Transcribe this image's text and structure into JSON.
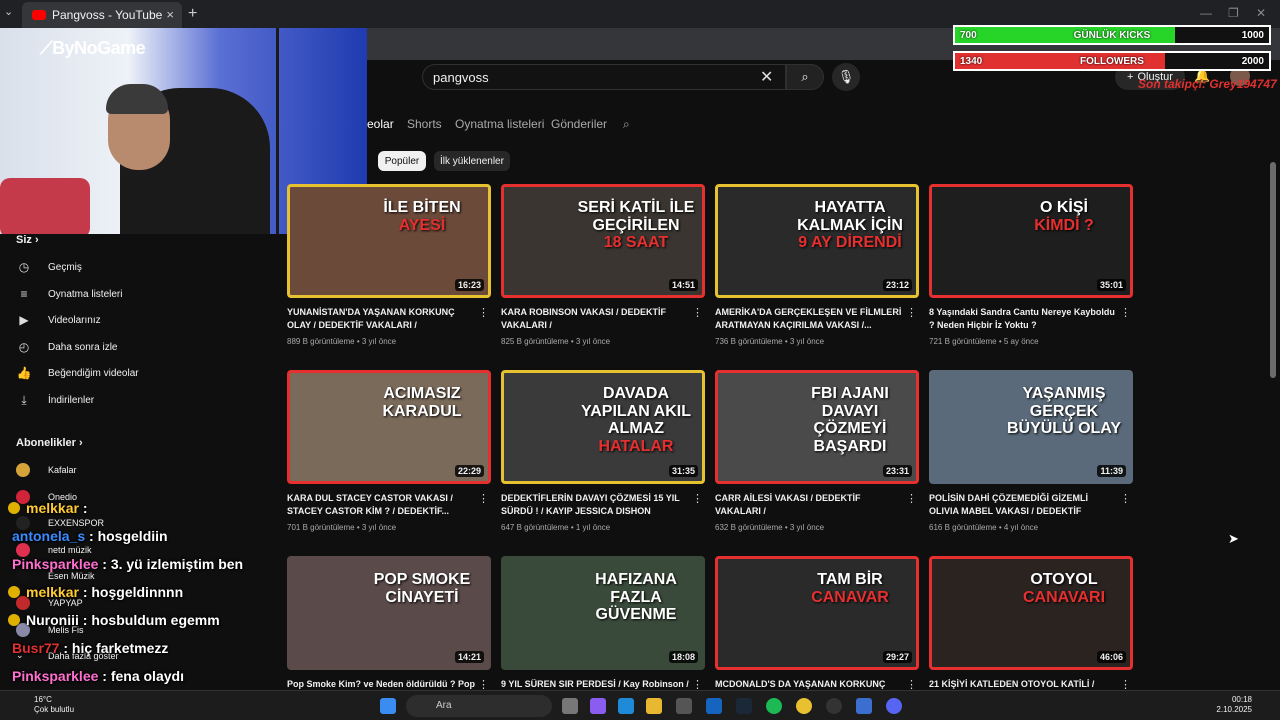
{
  "browser": {
    "tab_title": "Pangvoss - YouTube",
    "new_tab": "+",
    "tab_close": "×",
    "menu": "⌄"
  },
  "stream_overlay": {
    "logo": "ByNoGame",
    "stats": [
      {
        "current": "700",
        "label": "GÜNLÜK KICKS",
        "goal": "1000",
        "color": "#27d428",
        "fraction": 0.7
      },
      {
        "current": "1340",
        "label": "FOLLOWERS",
        "goal": "2000",
        "color": "#e03030",
        "fraction": 0.67
      }
    ],
    "last_follower": "Son takipçi: Grey194747"
  },
  "header": {
    "search_value": "pangvoss",
    "create_label": "Oluştur"
  },
  "channel_tabs": [
    "eolar",
    "Shorts",
    "Oynatma listeleri",
    "Gönderiler"
  ],
  "filters": [
    "Popüler",
    "İlk yüklenenler"
  ],
  "sidebar": {
    "you_heading": "Siz",
    "you_items": [
      "Geçmiş",
      "Oynatma listeleri",
      "Videolarınız",
      "Daha sonra izle",
      "Beğendiğim videolar",
      "İndirilenler"
    ],
    "subs_heading": "Abonelikler",
    "subs_items": [
      "Kafalar",
      "Onedio",
      "EXXENSPOR",
      "netd müzik",
      "Esen Müzik",
      "YAPYAP",
      "Melis Fis"
    ],
    "more": "Daha fazla göster"
  },
  "chat": [
    {
      "user": "melkkar",
      "msg": ":",
      "color": "#ffcc33"
    },
    {
      "user": "antonela_s",
      "msg": ": hosgeldiin",
      "color": "#3a8bff"
    },
    {
      "user": "Pinksparklee",
      "msg": ": 3. yü izlemiştim ben",
      "color": "#ff6fcf"
    },
    {
      "user": "melkkar",
      "msg": ": hoşgeldinnnn",
      "color": "#ffcc33"
    },
    {
      "user": "Nuroniii",
      "msg": ": hosbuldum egemm",
      "color": "#ffffff"
    },
    {
      "user": "Busr77",
      "msg": ": hiç farketmezz",
      "color": "#e03030"
    },
    {
      "user": "Pinksparklee",
      "msg": ": fena olaydı",
      "color": "#ff6fcf"
    }
  ],
  "videos": [
    {
      "thumb_text": "İLE BİTEN",
      "thumb_red": "AYESİ",
      "duration": "16:23",
      "title": "YUNANİSTAN'DA YAŞANAN KORKUNÇ OLAY / DEDEKTİF VAKALARI /",
      "meta": "889 B görüntüleme • 3 yıl önce",
      "bg": "#6b4a3a",
      "border": "yel"
    },
    {
      "thumb_text": "SERİ KATİL İLE GEÇİRİLEN",
      "thumb_red": "18 SAAT",
      "duration": "14:51",
      "title": "KARA ROBINSON VAKASI / DEDEKTİF VAKALARI /",
      "meta": "825 B görüntüleme • 3 yıl önce",
      "bg": "#3a3530",
      "border": "red"
    },
    {
      "thumb_text": "HAYATTA KALMAK İÇİN",
      "thumb_red": "9 AY DİRENDİ",
      "duration": "23:12",
      "title": "AMERİKA'DA GERÇEKLEŞEN VE FİLMLERİ ARATMAYAN KAÇIRILMA VAKASI /...",
      "meta": "736 B görüntüleme • 3 yıl önce",
      "bg": "#2a2a2a",
      "border": "yel"
    },
    {
      "thumb_text": "O KİŞİ",
      "thumb_red": "KİMDİ ?",
      "duration": "35:01",
      "title": "8 Yaşındaki Sandra Cantu Nereye Kayboldu ? Neden Hiçbir İz Yoktu ?",
      "meta": "721 B görüntüleme • 5 ay önce",
      "bg": "#1e1e1e",
      "border": "red"
    },
    {
      "thumb_text": "ACIMASIZ KARADUL",
      "thumb_red": "",
      "duration": "22:29",
      "title": "KARA DUL STACEY CASTOR VAKASI / STACEY CASTOR KİM ? / DEDEKTİF...",
      "meta": "701 B görüntüleme • 3 yıl önce",
      "bg": "#7a6a5a",
      "border": "red"
    },
    {
      "thumb_text": "DAVADA YAPILAN AKIL ALMAZ",
      "thumb_red": "HATALAR",
      "duration": "31:35",
      "title": "DEDEKTİFLERİN DAVAYI ÇÖZMESİ 15 YIL SÜRDÜ ! / KAYIP JESSICA DISHON DAVASI...",
      "meta": "647 B görüntüleme • 1 yıl önce",
      "bg": "#3a3a3a",
      "border": "yel"
    },
    {
      "thumb_text": "FBI AJANI DAVAYI ÇÖZMEYİ BAŞARDI",
      "thumb_red": "",
      "duration": "23:31",
      "title": "CARR AİLESİ VAKASI / DEDEKTİF VAKALARI /",
      "meta": "632 B görüntüleme • 3 yıl önce",
      "bg": "#4a4a4a",
      "border": "red"
    },
    {
      "thumb_text": "YAŞANMIŞ GERÇEK BÜYÜLÜ OLAY",
      "thumb_red": "",
      "duration": "11:39",
      "title": "POLİSİN DAHİ ÇÖZEMEDİĞİ GİZEMLİ OLIVIA MABEL VAKASI / DEDEKTİF VAKALARI /",
      "meta": "616 B görüntüleme • 4 yıl önce",
      "bg": "#5a6a7a",
      "border": "none"
    },
    {
      "thumb_text": "POP SMOKE CİNAYETİ",
      "thumb_red": "",
      "duration": "14:21",
      "title": "Pop Smoke Kim? ve Neden öldürüldü ? Pop",
      "meta": "",
      "bg": "#5a4a4a",
      "border": "none"
    },
    {
      "thumb_text": "HAFIZANA FAZLA GÜVENME",
      "thumb_red": "",
      "duration": "18:08",
      "title": "9 YIL SÜREN SIR PERDESİ / Kay Robinson /",
      "meta": "",
      "bg": "#3a4a3a",
      "border": "none"
    },
    {
      "thumb_text": "TAM BİR",
      "thumb_red": "CANAVAR",
      "duration": "29:27",
      "title": "MCDONALD'S DA YAŞANAN KORKUNÇ",
      "meta": "",
      "bg": "#2a2a2a",
      "border": "red"
    },
    {
      "thumb_text": "OTOYOL",
      "thumb_red": "CANAVARI",
      "duration": "46:06",
      "title": "21 KİŞİYİ KATLEDEN OTOYOL KATİLİ /",
      "meta": "",
      "bg": "#2a2320",
      "border": "red"
    }
  ],
  "taskbar": {
    "temp": "16°C",
    "weather": "Çok bulutlu",
    "search": "Ara",
    "time": "00:18",
    "date": "2.10.2025"
  }
}
